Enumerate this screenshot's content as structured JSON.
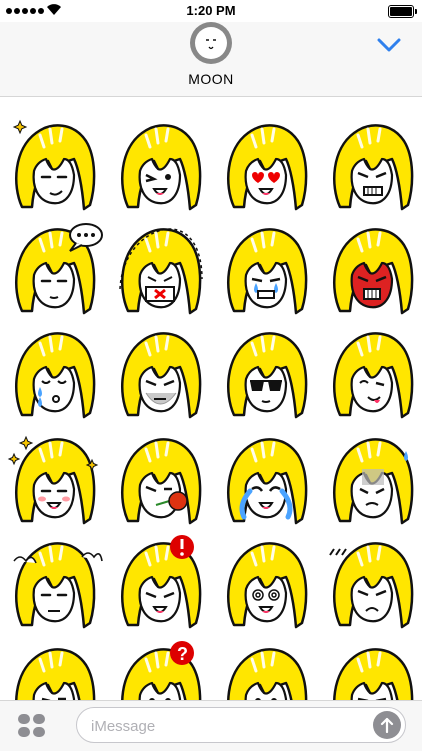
{
  "status_bar": {
    "time": "1:20 PM"
  },
  "header": {
    "contact_name": "MOON"
  },
  "compose": {
    "placeholder": "iMessage"
  },
  "stickers": [
    {
      "row": 0,
      "col": 0,
      "expr": "smug-sparkle"
    },
    {
      "row": 0,
      "col": 1,
      "expr": "wink"
    },
    {
      "row": 0,
      "col": 2,
      "expr": "heart-eyes"
    },
    {
      "row": 0,
      "col": 3,
      "expr": "grit-teeth"
    },
    {
      "row": 1,
      "col": 0,
      "expr": "speech-dots"
    },
    {
      "row": 1,
      "col": 1,
      "expr": "masked"
    },
    {
      "row": 1,
      "col": 2,
      "expr": "teary-grimace"
    },
    {
      "row": 1,
      "col": 3,
      "expr": "red-angry"
    },
    {
      "row": 2,
      "col": 0,
      "expr": "kiss-tears"
    },
    {
      "row": 2,
      "col": 1,
      "expr": "stubble"
    },
    {
      "row": 2,
      "col": 2,
      "expr": "sunglasses"
    },
    {
      "row": 2,
      "col": 3,
      "expr": "tongue-wink"
    },
    {
      "row": 3,
      "col": 0,
      "expr": "sparkle-blush"
    },
    {
      "row": 3,
      "col": 1,
      "expr": "rose"
    },
    {
      "row": 3,
      "col": 2,
      "expr": "crying"
    },
    {
      "row": 3,
      "col": 3,
      "expr": "gloomy-sweat"
    },
    {
      "row": 4,
      "col": 0,
      "expr": "fuming"
    },
    {
      "row": 4,
      "col": 1,
      "expr": "exclaim"
    },
    {
      "row": 4,
      "col": 2,
      "expr": "dizzy"
    },
    {
      "row": 4,
      "col": 3,
      "expr": "irritated"
    },
    {
      "row": 5,
      "col": 0,
      "expr": "tears"
    },
    {
      "row": 5,
      "col": 1,
      "expr": "question"
    },
    {
      "row": 5,
      "col": 2,
      "expr": "heart"
    },
    {
      "row": 5,
      "col": 3,
      "expr": "smirk"
    }
  ],
  "colors": {
    "hair": "#ffe600",
    "outline": "#111111",
    "accent_blue": "#2f80ed",
    "blush": "#ff9aa2"
  }
}
